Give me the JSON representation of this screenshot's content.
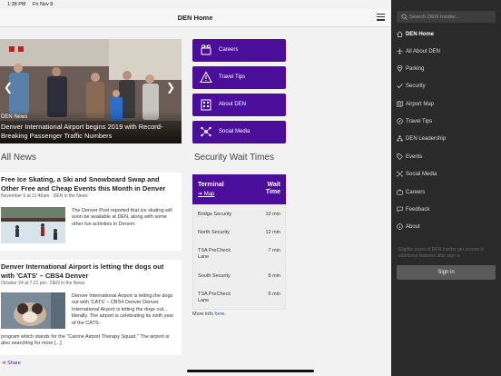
{
  "status_bar": {
    "time": "1:38 PM",
    "date": "Fri Nov 8"
  },
  "header": {
    "title": "DEN Home"
  },
  "hero": {
    "tag": "DEN News",
    "headline": "Denver International Airport begins 2019 with Record-Breaking Passenger Traffic Numbers"
  },
  "nav_buttons": [
    {
      "label": "Careers",
      "icon": "careers-icon"
    },
    {
      "label": "Travel Tips",
      "icon": "warning-icon"
    },
    {
      "label": "About DEN",
      "icon": "building-icon"
    },
    {
      "label": "Social Media",
      "icon": "social-network-icon"
    }
  ],
  "all_news": {
    "title": "All News",
    "articles": [
      {
        "title": "Free Ice Skating, a Ski and Snowboard Swap and Other Free and Cheap Events this Month in Denver",
        "meta": "November 6 at 11:46am · DEN in the News",
        "body": "The Denver Post reported that ice skating will soon be available at DEN, along with some other fun activities in Denver."
      },
      {
        "title": "Denver International Airport is letting the dogs out with 'CATS' – CBS4 Denver",
        "meta": "October 24 at 7:21 pm · DEN in the News",
        "body": "Denver International Airport is letting the dogs out with 'CATS' – CBS4 Denver Denver International Airport is letting the dogs out... literally. The airport is celebrating its sixth year of the CATS-",
        "body_continued": "program which stands for the \"Canine Airport Therapy Squad.\" The airport is also searching for more [...]"
      }
    ],
    "share_label": "Share"
  },
  "wait_times": {
    "title": "Security Wait Times",
    "col_terminal": "Terminal",
    "map_label": "➔ Map",
    "col_wait_1": "Wait",
    "col_wait_2": "Time",
    "rows": [
      {
        "name": "Bridge Security",
        "time": "10 min"
      },
      {
        "name": "North Security",
        "time": "12 min"
      },
      {
        "name": "TSA PreCheck Lane",
        "time": "7 min"
      },
      {
        "name": "South Security",
        "time": "8 min"
      },
      {
        "name": "TSA PreCheck Lane",
        "time": "6 min"
      }
    ],
    "more_prefix": "More info ",
    "more_link": "here."
  },
  "drawer": {
    "search_placeholder": "Search DEN Insider...",
    "items": [
      {
        "label": "DEN Home",
        "icon": "home-icon",
        "active": true
      },
      {
        "label": "All About DEN",
        "icon": "plane-icon"
      },
      {
        "label": "Parking",
        "icon": "location-pin-icon"
      },
      {
        "label": "Security",
        "icon": "checkmark-icon"
      },
      {
        "label": "Airport Map",
        "icon": "map-icon"
      },
      {
        "label": "Travel Tips",
        "icon": "compass-icon"
      },
      {
        "label": "DEN Leadership",
        "icon": "org-chart-icon"
      },
      {
        "label": "Events",
        "icon": "tag-icon"
      },
      {
        "label": "Social Media",
        "icon": "social-network-icon"
      },
      {
        "label": "Careers",
        "icon": "briefcase-icon"
      },
      {
        "label": "Feedback",
        "icon": "chat-bubble-icon"
      },
      {
        "label": "About",
        "icon": "info-icon"
      }
    ],
    "note": "Eligible users of DEN Insider get access to additional features after sign in",
    "signin_label": "Sign in"
  },
  "colors": {
    "brand_purple": "#4b0e9a",
    "drawer_bg": "#2a2a2a",
    "link_blue": "#1a52c0"
  }
}
